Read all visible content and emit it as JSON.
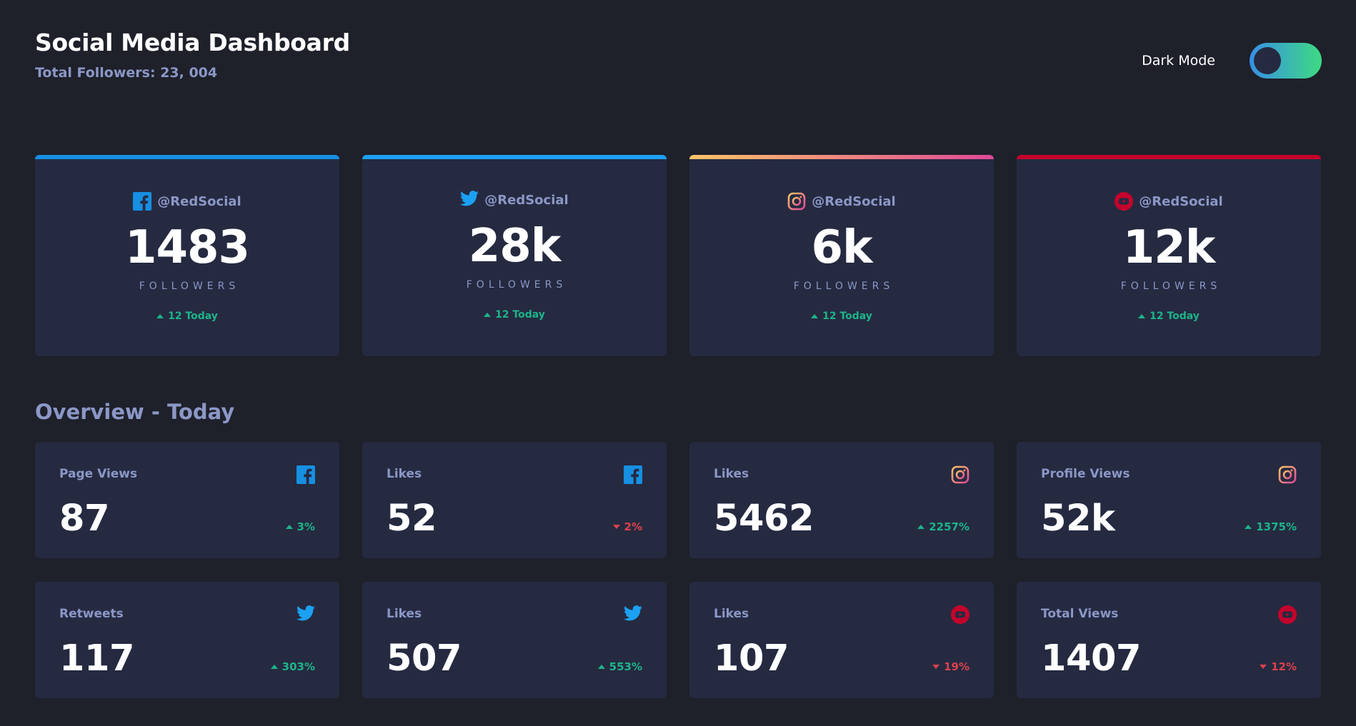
{
  "header": {
    "title": "Social Media Dashboard",
    "total_followers": "Total Followers: 23, 004",
    "mode_label": "Dark Mode"
  },
  "colors": {
    "facebook": "#178fe2",
    "twitter": "#1ca0f2",
    "instagram_start": "#fdc468",
    "instagram_end": "#df4996",
    "youtube": "#c4032b",
    "up": "#1db489",
    "down": "#dc414c"
  },
  "followers": [
    {
      "network": "facebook",
      "icon": "facebook-icon",
      "handle": "@RedSocial",
      "count": "1483",
      "label": "FOLLOWERS",
      "today": "12 Today",
      "trend": "up"
    },
    {
      "network": "twitter",
      "icon": "twitter-icon",
      "handle": "@RedSocial",
      "count": "28k",
      "label": "FOLLOWERS",
      "today": "12 Today",
      "trend": "up"
    },
    {
      "network": "instagram",
      "icon": "instagram-icon",
      "handle": "@RedSocial",
      "count": "6k",
      "label": "FOLLOWERS",
      "today": "12 Today",
      "trend": "up"
    },
    {
      "network": "youtube",
      "icon": "youtube-icon",
      "handle": "@RedSocial",
      "count": "12k",
      "label": "FOLLOWERS",
      "today": "12 Today",
      "trend": "up"
    }
  ],
  "overview": {
    "title": "Overview - Today",
    "cards": [
      {
        "label": "Page Views",
        "icon": "facebook-icon",
        "value": "87",
        "change": "3%",
        "trend": "up"
      },
      {
        "label": "Likes",
        "icon": "facebook-icon",
        "value": "52",
        "change": "2%",
        "trend": "down"
      },
      {
        "label": "Likes",
        "icon": "instagram-icon",
        "value": "5462",
        "change": "2257%",
        "trend": "up"
      },
      {
        "label": "Profile Views",
        "icon": "instagram-icon",
        "value": "52k",
        "change": "1375%",
        "trend": "up"
      },
      {
        "label": "Retweets",
        "icon": "twitter-icon",
        "value": "117",
        "change": "303%",
        "trend": "up"
      },
      {
        "label": "Likes",
        "icon": "twitter-icon",
        "value": "507",
        "change": "553%",
        "trend": "up"
      },
      {
        "label": "Likes",
        "icon": "youtube-icon",
        "value": "107",
        "change": "19%",
        "trend": "down"
      },
      {
        "label": "Total Views",
        "icon": "youtube-icon",
        "value": "1407",
        "change": "12%",
        "trend": "down"
      }
    ]
  }
}
